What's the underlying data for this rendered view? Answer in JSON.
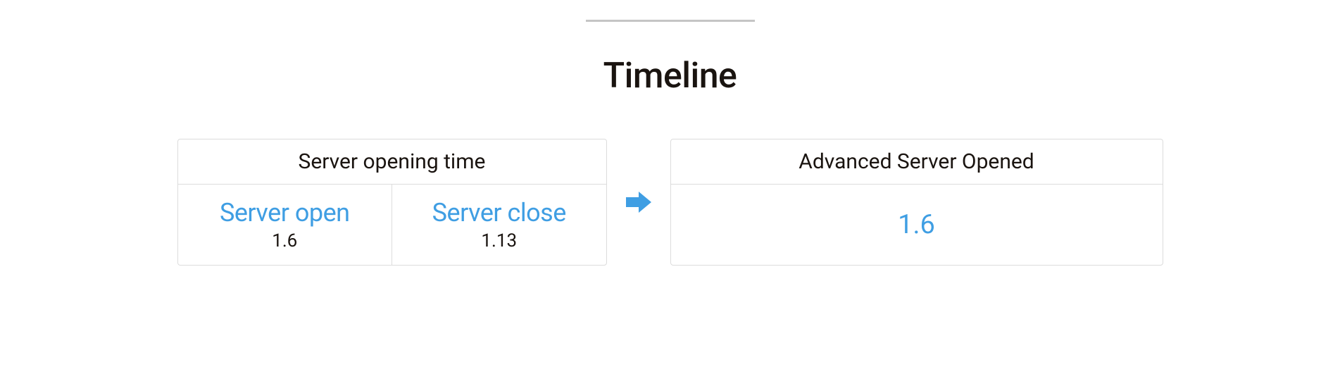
{
  "title": "Timeline",
  "colors": {
    "accent": "#3f9ee3",
    "text": "#1a1410",
    "border": "#dcdcdc",
    "divider": "#c5c5c5"
  },
  "left_box": {
    "header": "Server opening time",
    "cells": [
      {
        "label": "Server open",
        "value": "1.6"
      },
      {
        "label": "Server close",
        "value": "1.13"
      }
    ]
  },
  "right_box": {
    "header": "Advanced Server Opened",
    "value": "1.6"
  },
  "arrow": {
    "name": "arrow-right-icon"
  }
}
